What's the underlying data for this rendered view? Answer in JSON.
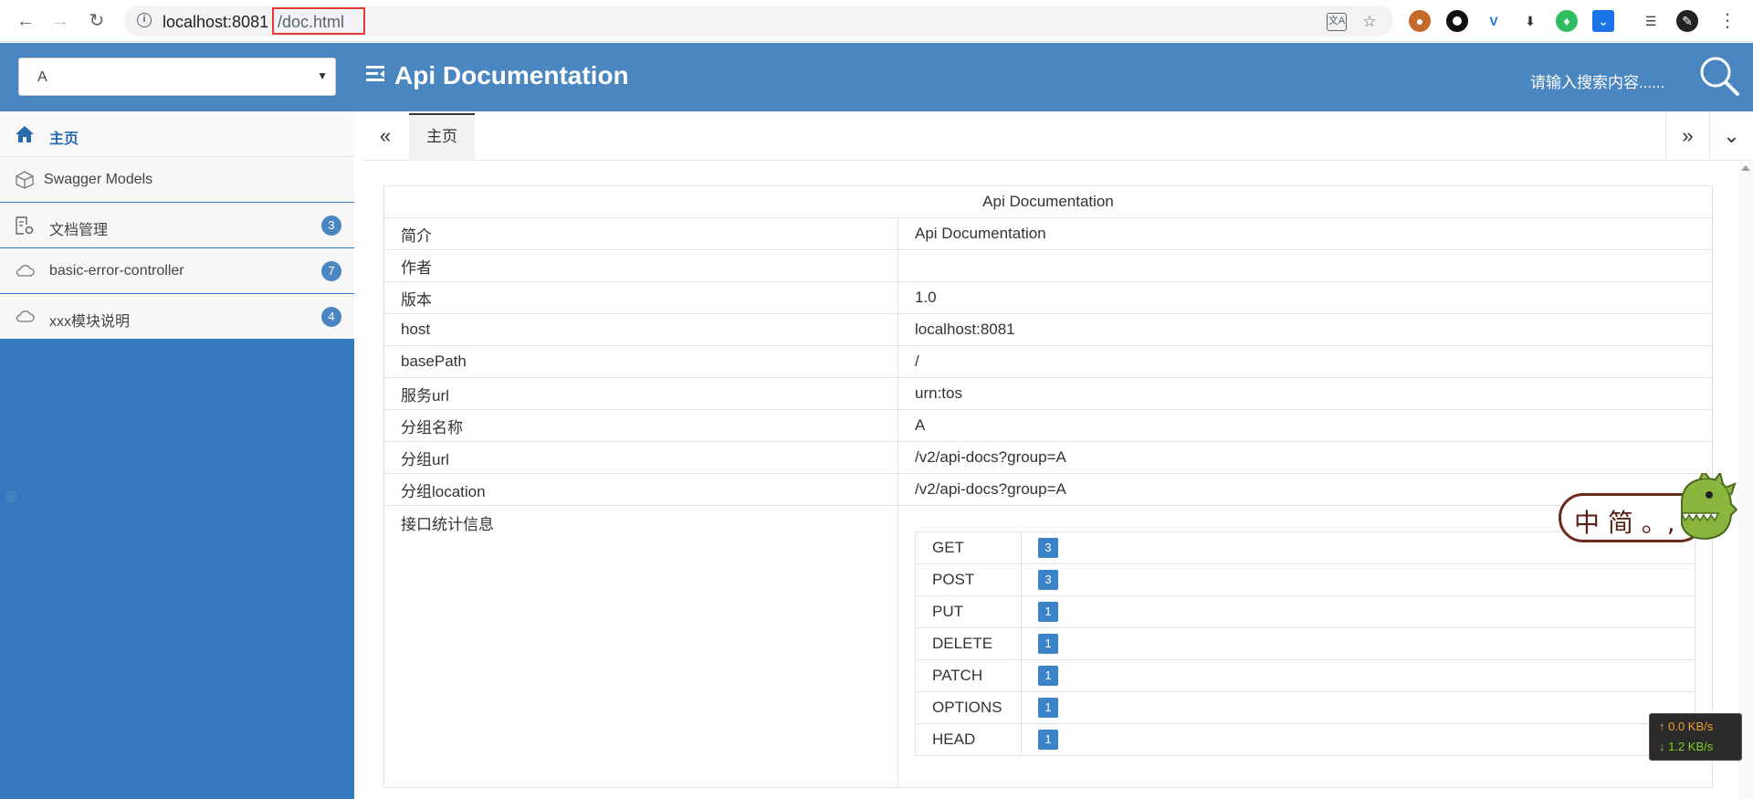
{
  "browser": {
    "url_host": "localhost:8081",
    "url_path": "/doc.html"
  },
  "header": {
    "group_selected": "A",
    "title": "Api Documentation",
    "search_placeholder": "请输入搜索内容......"
  },
  "sidebar": {
    "items": [
      {
        "label": "主页",
        "icon": "home-icon"
      },
      {
        "label": "Swagger Models",
        "icon": "cube-icon"
      },
      {
        "label": "文档管理",
        "icon": "doc-gear-icon",
        "badge": "3"
      },
      {
        "label": "basic-error-controller",
        "icon": "cloud-api-icon",
        "badge": "7"
      },
      {
        "label": "xxx模块说明",
        "icon": "cloud-api-icon",
        "badge": "4"
      }
    ]
  },
  "tabs": {
    "items": [
      {
        "label": "主页"
      }
    ]
  },
  "doc": {
    "header": "Api Documentation",
    "rows": [
      {
        "key": "简介",
        "value": "Api Documentation"
      },
      {
        "key": "作者",
        "value": ""
      },
      {
        "key": "版本",
        "value": "1.0"
      },
      {
        "key": "host",
        "value": "localhost:8081"
      },
      {
        "key": "basePath",
        "value": "/"
      },
      {
        "key": "服务url",
        "value": "urn:tos"
      },
      {
        "key": "分组名称",
        "value": "A"
      },
      {
        "key": "分组url",
        "value": "/v2/api-docs?group=A"
      },
      {
        "key": "分组location",
        "value": "/v2/api-docs?group=A"
      }
    ],
    "stats_label": "接口统计信息",
    "stats": [
      {
        "method": "GET",
        "count": "3"
      },
      {
        "method": "POST",
        "count": "3"
      },
      {
        "method": "PUT",
        "count": "1"
      },
      {
        "method": "DELETE",
        "count": "1"
      },
      {
        "method": "PATCH",
        "count": "1"
      },
      {
        "method": "OPTIONS",
        "count": "1"
      },
      {
        "method": "HEAD",
        "count": "1"
      }
    ]
  },
  "ime": {
    "text": "中 简 。,"
  },
  "netspeed": {
    "up": "0.0 KB/s",
    "down": "1.2 KB/s"
  },
  "colors": {
    "header": "#4a86c0",
    "sidebar": "#3479bf",
    "badge": "#3a83c9"
  }
}
